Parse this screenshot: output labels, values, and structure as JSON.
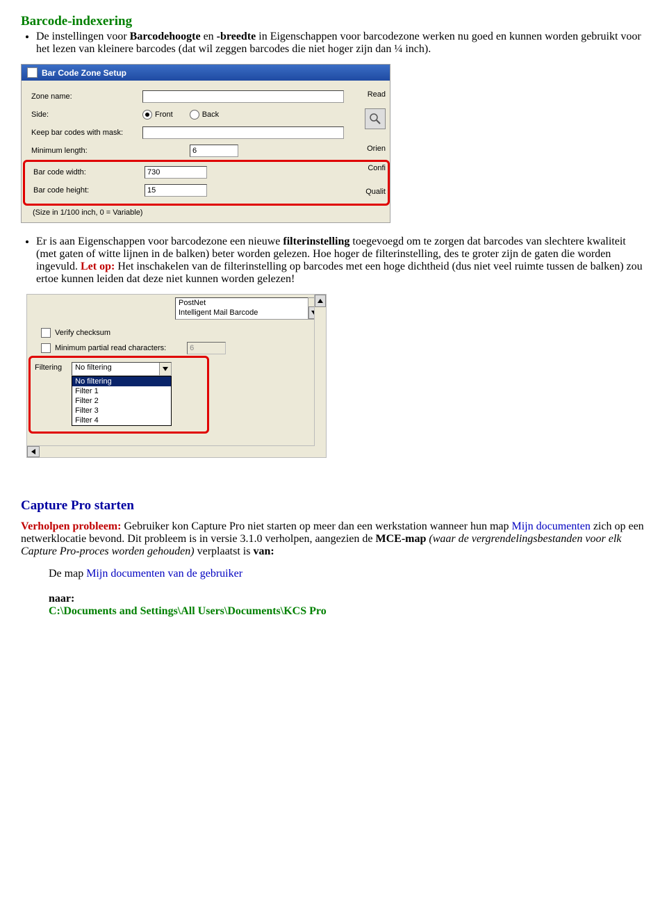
{
  "section1": {
    "title": "Barcode-indexering",
    "bullet1_pre": "De instellingen voor ",
    "bullet1_b1": "Barcodehoogte",
    "bullet1_mid": " en ",
    "bullet1_b2": "-breedte",
    "bullet1_tail": " in Eigenschappen voor barcodezone werken nu goed en kunnen worden gebruikt voor het lezen van kleinere barcodes (dat wil zeggen barcodes die niet hoger zijn dan ¼ inch)."
  },
  "ui1": {
    "title": "Bar Code Zone Setup",
    "labels": {
      "zone_name": "Zone name:",
      "side": "Side:",
      "front": "Front",
      "back": "Back",
      "keep_mask": "Keep bar codes with mask:",
      "min_length": "Minimum length:",
      "bc_width": "Bar code width:",
      "bc_height": "Bar code height:",
      "size_note": "(Size in 1/100 inch, 0 = Variable)"
    },
    "values": {
      "zone_name": "",
      "min_length": "6",
      "bc_width": "730",
      "bc_height": "15"
    },
    "trunc": {
      "read": "Read",
      "orien": "Orien",
      "confi": "Confi",
      "qualit": "Qualit"
    }
  },
  "section1b": {
    "pre": "Er is aan Eigenschappen voor barcodezone een nieuwe ",
    "b1": "filterinstelling",
    "mid1": " toegevoegd om te zorgen dat barcodes van slechtere kwaliteit (met gaten of witte lijnen in de balken) beter worden gelezen. Hoe hoger de filterinstelling, des te groter zijn de gaten die worden ingevuld. ",
    "let_op": "Let op:",
    "tail": " Het inschakelen van de filterinstelling op barcodes met een hoge dichtheid (dus niet veel ruimte tussen de balken) zou ertoe kunnen leiden dat deze niet kunnen worden gelezen!"
  },
  "ui2": {
    "list_items": [
      "PostNet",
      "Intelligent Mail Barcode"
    ],
    "verify": "Verify checksum",
    "min_partial": "Minimum partial read characters:",
    "min_partial_value": "6",
    "filtering_label": "Filtering",
    "combo_value": "No filtering",
    "options": [
      "No filtering",
      "Filter 1",
      "Filter 2",
      "Filter 3",
      "Filter 4"
    ]
  },
  "section2": {
    "title": "Capture Pro starten",
    "para_pre": "Verholpen probleem:",
    "para_mid1": " Gebruiker kon Capture Pro niet starten op meer dan een werkstation wanneer hun map ",
    "mijn_doc": "Mijn documenten",
    "para_mid2": " zich op een netwerklocatie bevond. Dit probleem is in versie 3.1.0 verholpen, aangezien de ",
    "mce": "MCE-map",
    "para_mid3": " (waar de vergrendelingsbestanden voor elk Capture Pro-proces worden gehouden)",
    "para_mid4": " verplaatst is ",
    "van": "van:",
    "line1": "De map ",
    "line1b": "Mijn documenten van de gebruiker",
    "naar": "naar:",
    "path": "C:\\Documents and Settings\\All Users\\Documents\\KCS Pro"
  }
}
